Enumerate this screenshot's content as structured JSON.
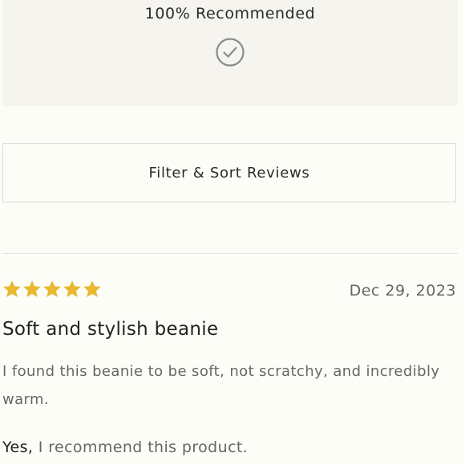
{
  "recommendation": {
    "percent_text": "100% Recommended",
    "icon": "check-circle-icon"
  },
  "filter": {
    "label": "Filter & Sort Reviews"
  },
  "review": {
    "rating": 5,
    "max_rating": 5,
    "star_color": "#E8B92F",
    "date": "Dec 29, 2023",
    "title": "Soft and stylish beanie",
    "body": "I found this beanie to be soft, not scratchy, and incredibly warm.",
    "recommend_answer": "Yes,",
    "recommend_text": " I recommend this product."
  }
}
